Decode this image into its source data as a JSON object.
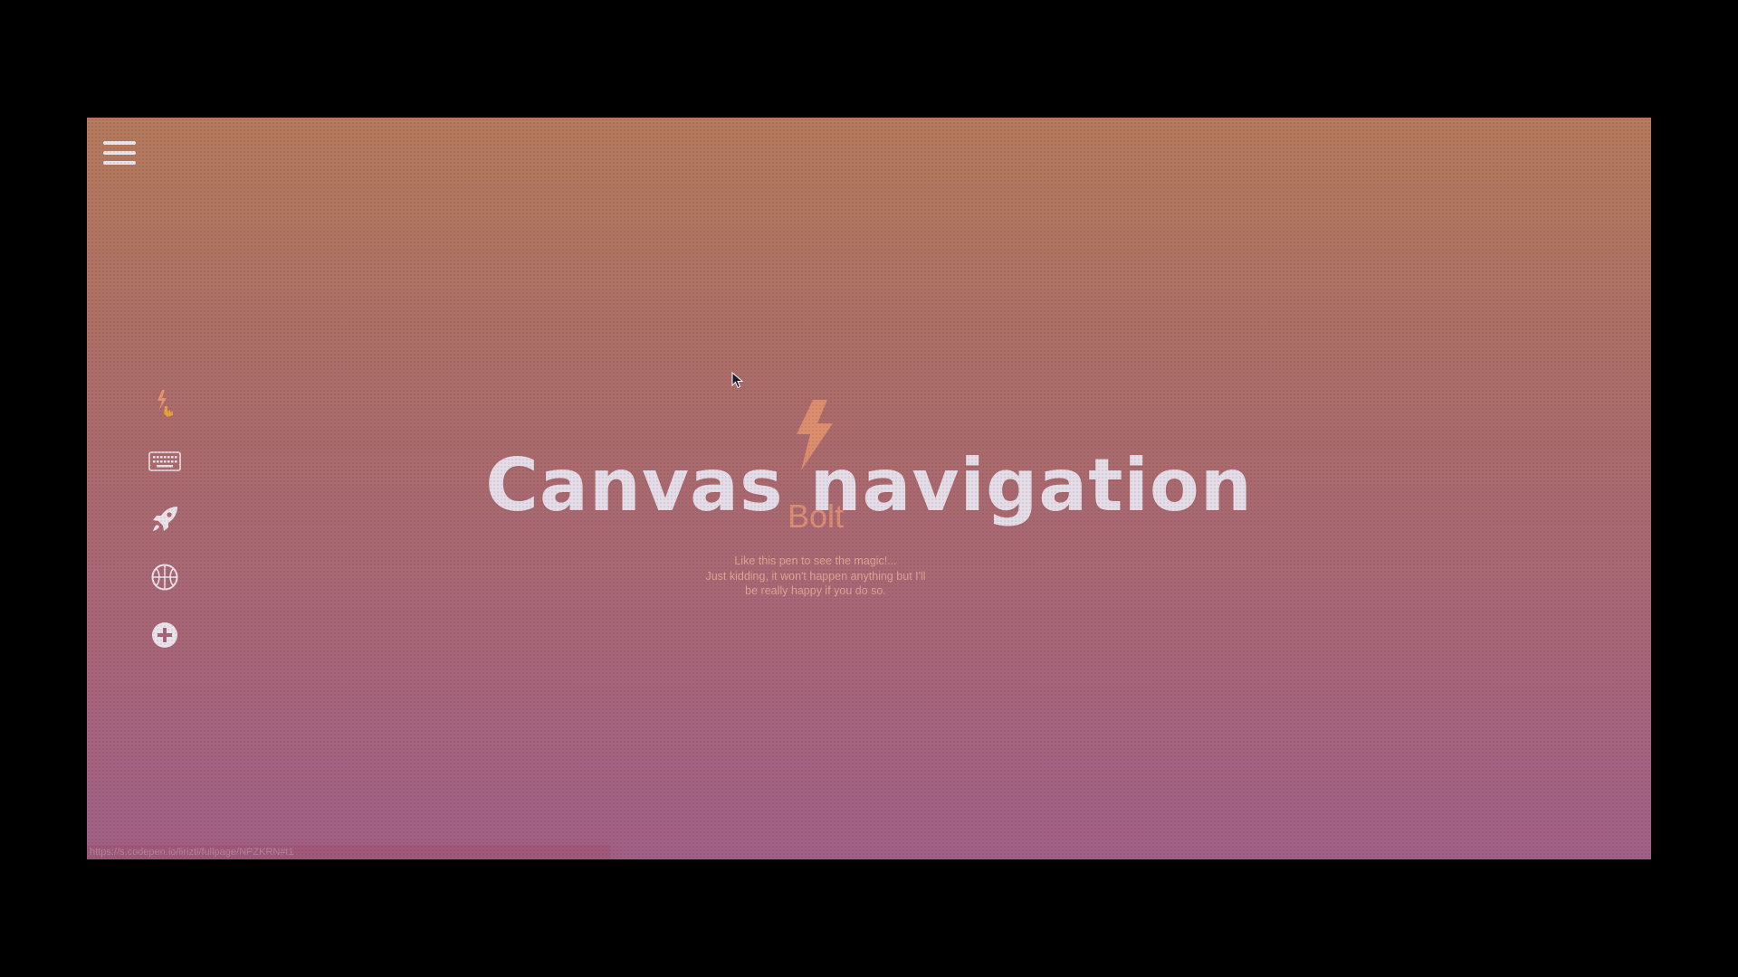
{
  "hero": {
    "title": "Canvas navigation",
    "active_label": "Bolt",
    "message_lines": [
      "Like this pen to see the magic!...",
      "Just kidding, it won't happen anything but I'll",
      "be really happy if you do so."
    ]
  },
  "sidebar": {
    "items": [
      {
        "icon": "bolt-hand-icon",
        "active": true
      },
      {
        "icon": "keyboard-icon",
        "active": false
      },
      {
        "icon": "rocket-icon",
        "active": false
      },
      {
        "icon": "basketball-icon",
        "active": false
      },
      {
        "icon": "plus-circle-icon",
        "active": false
      }
    ]
  },
  "status_bar": {
    "url": "https://s.codepen.io/liriztl/fullpage/NPZKRN#t1"
  },
  "colors": {
    "background_top": "#b47a5c",
    "background_bottom": "#a15f86",
    "accent": "#e4946f",
    "title": "#eae5f0",
    "icon": "#ebe3ea"
  }
}
